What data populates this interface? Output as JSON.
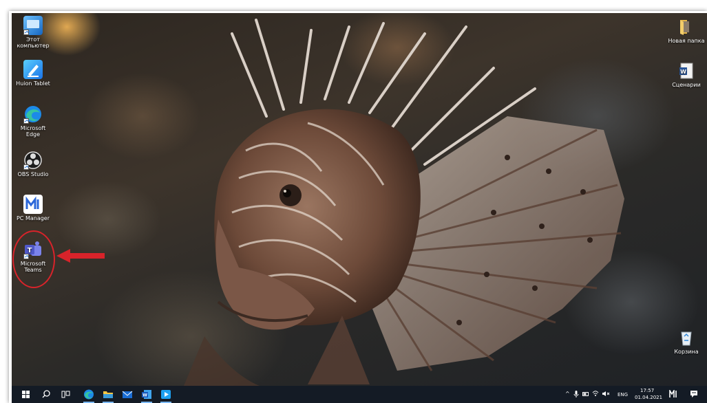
{
  "desktop": {
    "left_icons": [
      {
        "label": "Этот компьютер",
        "icon": "this-pc-icon"
      },
      {
        "label": "Huion Tablet",
        "icon": "huion-tablet-icon"
      },
      {
        "label": "Microsoft Edge",
        "icon": "edge-icon"
      },
      {
        "label": "OBS Studio",
        "icon": "obs-icon"
      },
      {
        "label": "PC Manager",
        "icon": "pc-manager-icon"
      },
      {
        "label": "Microsoft Teams",
        "icon": "teams-icon"
      }
    ],
    "right_icons": [
      {
        "label": "Новая папка",
        "icon": "folder-icon"
      },
      {
        "label": "Сценарии",
        "icon": "word-document-icon"
      },
      {
        "label": "Корзина",
        "icon": "recycle-bin-icon"
      }
    ]
  },
  "taskbar": {
    "pinned": [
      "start-icon",
      "search-icon",
      "task-view-icon",
      "edge-icon",
      "file-explorer-icon",
      "mail-icon",
      "word-icon",
      "media-player-icon"
    ],
    "tray": {
      "language": "ENG",
      "time": "17:57",
      "date": "01.04.2021"
    }
  },
  "annotation": {
    "color": "#d8232a",
    "target": "Microsoft Teams"
  },
  "colors": {
    "taskbar_bg": "#141b25",
    "edge_blue": "#1c8ae8",
    "teams_purple": "#5059c9"
  }
}
